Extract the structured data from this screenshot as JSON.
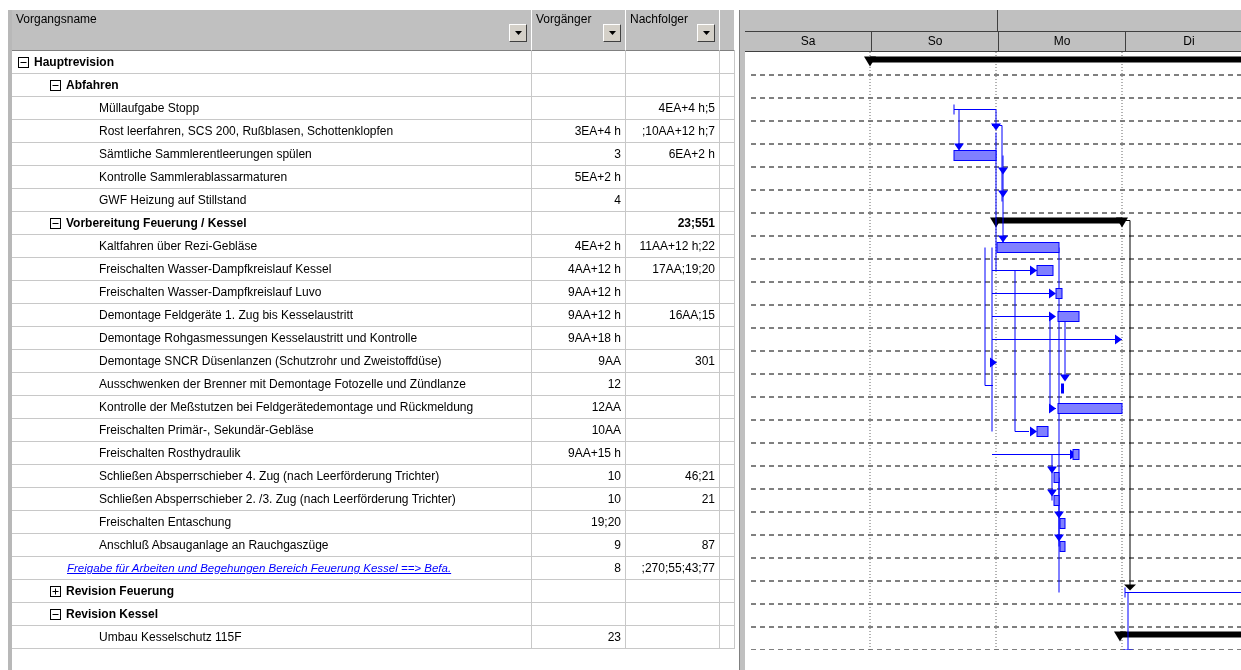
{
  "table": {
    "columns": [
      "Vorgangsname",
      "Vorgänger",
      "Nachfolger"
    ],
    "rows": [
      {
        "name": "Hauptrevision",
        "kind": "summary",
        "expanded": true,
        "children": [
          {
            "name": "Abfahren",
            "kind": "summary",
            "expanded": true,
            "children": [
              {
                "name": "Müllaufgabe Stopp",
                "kind": "task",
                "successors": "4EA+4 h;5"
              },
              {
                "name": "Rost leerfahren, SCS 200, Rußblasen, Schottenklopfen",
                "kind": "task",
                "predecessors": "3EA+4 h",
                "successors": ";10AA+12 h;7"
              },
              {
                "name": "Sämtliche Sammlerentleerungen spülen",
                "kind": "task",
                "predecessors": "3",
                "successors": "6EA+2 h"
              },
              {
                "name": "Kontrolle Sammlerablassarmaturen",
                "kind": "task",
                "predecessors": "5EA+2 h"
              },
              {
                "name": "GWF Heizung auf Stillstand",
                "kind": "task",
                "predecessors": "4"
              }
            ]
          },
          {
            "name": "Vorbereitung Feuerung / Kessel",
            "kind": "summary",
            "expanded": true,
            "successors": "23;551",
            "children": [
              {
                "name": "Kaltfahren über Rezi-Gebläse",
                "kind": "task",
                "predecessors": "4EA+2 h",
                "successors": "11AA+12 h;22"
              },
              {
                "name": "Freischalten Wasser-Dampfkreislauf Kessel",
                "kind": "task",
                "predecessors": "4AA+12 h",
                "successors": "17AA;19;20"
              },
              {
                "name": "Freischalten Wasser-Dampfkreislauf Luvo",
                "kind": "task",
                "predecessors": "9AA+12 h"
              },
              {
                "name": "Demontage Feldgeräte 1. Zug bis Kesselaustritt",
                "kind": "task",
                "predecessors": "9AA+12 h",
                "successors": "16AA;15"
              },
              {
                "name": "Demontage Rohgasmessungen Kesselaustritt und Kontrolle",
                "kind": "task",
                "predecessors": "9AA+18 h"
              },
              {
                "name": "Demontage SNCR Düsenlanzen (Schutzrohr und Zweistoffdüse)",
                "kind": "task",
                "predecessors": "9AA",
                "successors": "301"
              },
              {
                "name": "Ausschwenken der Brenner mit Demontage Fotozelle und Zündlanze",
                "kind": "task",
                "predecessors": "12"
              },
              {
                "name": "Kontrolle der Meßstutzen bei Feldgerätedemontage und Rückmeldung",
                "kind": "task",
                "predecessors": "12AA"
              },
              {
                "name": "Freischalten Primär-, Sekundär-Gebläse",
                "kind": "task",
                "predecessors": "10AA"
              },
              {
                "name": "Freischalten Rosthydraulik",
                "kind": "task",
                "predecessors": "9AA+15 h"
              },
              {
                "name": "Schließen Absperrschieber 4. Zug (nach Leerförderung Trichter)",
                "kind": "task",
                "predecessors": "10",
                "successors": "46;21"
              },
              {
                "name": "Schließen Absperrschieber 2. /3. Zug (nach Leerförderung Trichter)",
                "kind": "task",
                "predecessors": "10",
                "successors": "21"
              },
              {
                "name": "Freischalten Entaschung",
                "kind": "task",
                "predecessors": "19;20"
              },
              {
                "name": "Anschluß Absauganlage an Rauchgaszüge",
                "kind": "task",
                "predecessors": "9",
                "successors": "87"
              }
            ]
          },
          {
            "name": "Freigabe für Arbeiten und Begehungen Bereich Feuerung Kessel ==> Befa.",
            "kind": "link",
            "predecessors": "8",
            "successors": ";270;55;43;77"
          },
          {
            "name": "Revision Feuerung",
            "kind": "summary",
            "expanded": false
          },
          {
            "name": "Revision Kessel",
            "kind": "summary",
            "expanded": true,
            "children": [
              {
                "name": "Umbau Kesselschutz 115F",
                "kind": "task",
                "predecessors": "23"
              }
            ]
          }
        ]
      }
    ]
  },
  "gantt": {
    "days": [
      "Sa",
      "So",
      "Mo",
      "Di"
    ]
  }
}
